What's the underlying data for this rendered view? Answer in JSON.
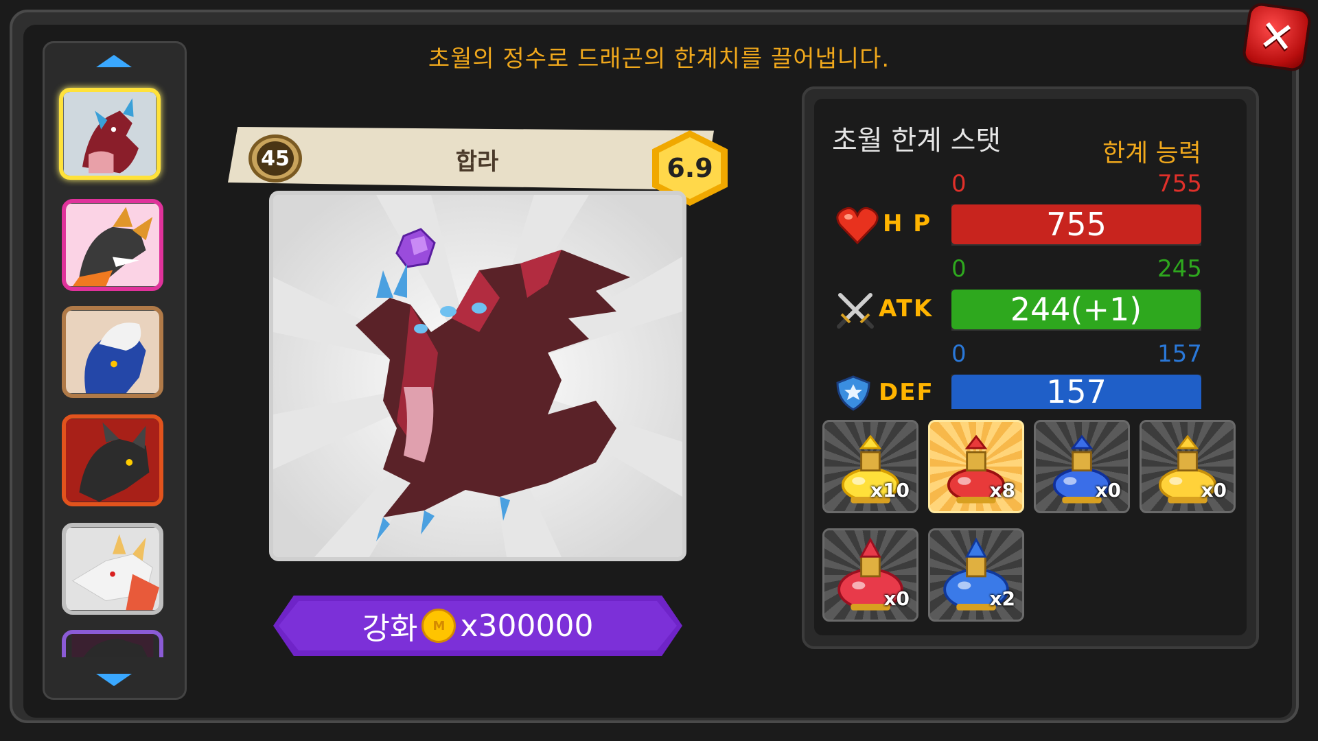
{
  "message": "초월의 정수로 드래곤의 한계치를 끌어냅니다.",
  "close_label": "✕",
  "sidebar": {
    "items": [
      {
        "name": "dragon-red",
        "selected": true,
        "border": "#ffe23a"
      },
      {
        "name": "dragon-black-gold",
        "selected": false,
        "border": "#e0329b"
      },
      {
        "name": "dragon-white-blue",
        "selected": false,
        "border": "#b07a48"
      },
      {
        "name": "dragon-black-flame",
        "selected": false,
        "border": "#e2531d"
      },
      {
        "name": "dragon-white-red",
        "selected": false,
        "border": "#bfbfbf"
      },
      {
        "name": "dragon-partial",
        "selected": false,
        "border": "#8b5bd6"
      }
    ]
  },
  "dragon": {
    "level": "45",
    "name": "합라",
    "grade": "6.9"
  },
  "upgrade": {
    "label": "강화",
    "coin_symbol": "M",
    "cost": "x300000"
  },
  "stats": {
    "title": "초월 한계 스탯",
    "subtitle": "한계 능력",
    "rows": [
      {
        "key": "hp",
        "label": "H P",
        "min": "0",
        "max": "755",
        "value_text": "755",
        "value": 755,
        "cap": 755,
        "color": "#c8241e",
        "range_color": "#e0302a"
      },
      {
        "key": "atk",
        "label": "ATK",
        "min": "0",
        "max": "245",
        "value_text": "244(+1)",
        "value": 244,
        "cap": 245,
        "color": "#2ea81e",
        "range_color": "#2ea81e"
      },
      {
        "key": "def",
        "label": "DEF",
        "min": "0",
        "max": "157",
        "value_text": "157",
        "value": 157,
        "cap": 157,
        "color": "#1f5fc8",
        "range_color": "#2a78d8"
      }
    ]
  },
  "items": [
    {
      "qty": "x10",
      "color": "yellow",
      "selected": false
    },
    {
      "qty": "x8",
      "color": "red",
      "selected": true
    },
    {
      "qty": "x0",
      "color": "blue",
      "selected": false
    },
    {
      "qty": "x0",
      "color": "gold",
      "selected": false
    },
    {
      "qty": "x0",
      "color": "red-large",
      "selected": false
    },
    {
      "qty": "x2",
      "color": "blue-large",
      "selected": false
    }
  ]
}
